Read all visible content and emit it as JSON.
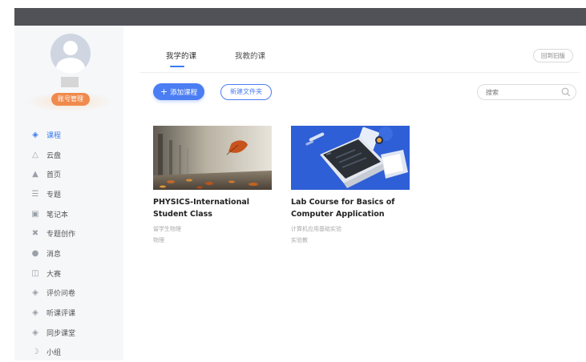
{
  "sidebar": {
    "account_button": "账号管理",
    "items": [
      {
        "label": "课程",
        "icon": "graduation-cap-icon",
        "active": true
      },
      {
        "label": "云盘",
        "icon": "cloud-icon"
      },
      {
        "label": "首页",
        "icon": "home-icon"
      },
      {
        "label": "专题",
        "icon": "list-icon"
      },
      {
        "label": "笔记本",
        "icon": "notebook-icon"
      },
      {
        "label": "专题创作",
        "icon": "tools-icon"
      },
      {
        "label": "消息",
        "icon": "message-icon"
      },
      {
        "label": "大赛",
        "icon": "book-icon"
      },
      {
        "label": "评价问卷",
        "icon": "cap-icon"
      },
      {
        "label": "听课评课",
        "icon": "cap-icon"
      },
      {
        "label": "同步课堂",
        "icon": "cap-icon"
      },
      {
        "label": "小组",
        "icon": "group-icon"
      }
    ]
  },
  "main": {
    "tabs": [
      {
        "label": "我学的课",
        "active": true
      },
      {
        "label": "我教的课"
      }
    ],
    "old_version_button": "回到旧版",
    "add_course_button": "添加课程",
    "new_folder_button": "新建文件夹",
    "search": {
      "placeholder": "搜索"
    },
    "courses": [
      {
        "title": "PHYSICS-International Student Class",
        "meta1": "留学生物理",
        "meta2": "物理"
      },
      {
        "title": "Lab Course for Basics of Computer Application",
        "meta1": "计算机应用基础实验",
        "meta2": "实验教"
      }
    ]
  },
  "colors": {
    "accent": "#3a7bf0",
    "button_blue": "#4b7df3",
    "account_orange": "#ef8a4d",
    "topbar": "#505257"
  }
}
